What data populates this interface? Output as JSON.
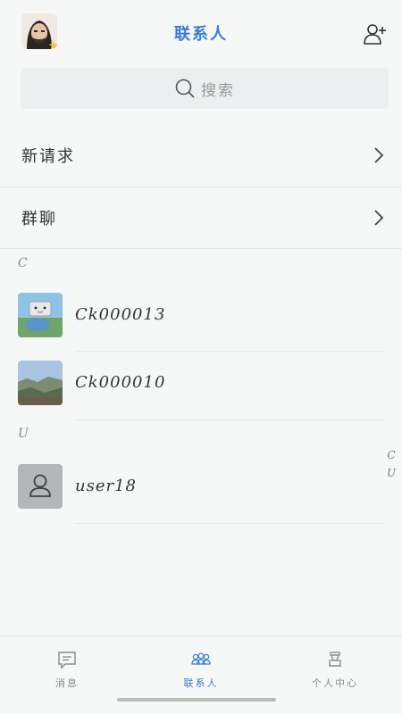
{
  "header": {
    "title": "联系人",
    "add_friend_icon": "add-person-icon"
  },
  "search": {
    "placeholder": "搜索",
    "icon": "search-icon"
  },
  "menu": [
    {
      "label": "新请求",
      "icon": "chevron-right-icon"
    },
    {
      "label": "群聊",
      "icon": "chevron-right-icon"
    }
  ],
  "sections": [
    {
      "letter": "C",
      "contacts": [
        {
          "name": "Ck000013"
        },
        {
          "name": "Ck000010"
        }
      ]
    },
    {
      "letter": "U",
      "contacts": [
        {
          "name": "user18"
        }
      ]
    }
  ],
  "index_bar": [
    "C",
    "U"
  ],
  "tabs": [
    {
      "label": "消息",
      "icon": "message-icon",
      "active": false
    },
    {
      "label": "联系人",
      "icon": "contacts-icon",
      "active": true
    },
    {
      "label": "个人中心",
      "icon": "profile-icon",
      "active": false
    }
  ],
  "colors": {
    "accent": "#3a7bd5",
    "background": "#f6f8f8",
    "search_bg": "#eceef0"
  }
}
